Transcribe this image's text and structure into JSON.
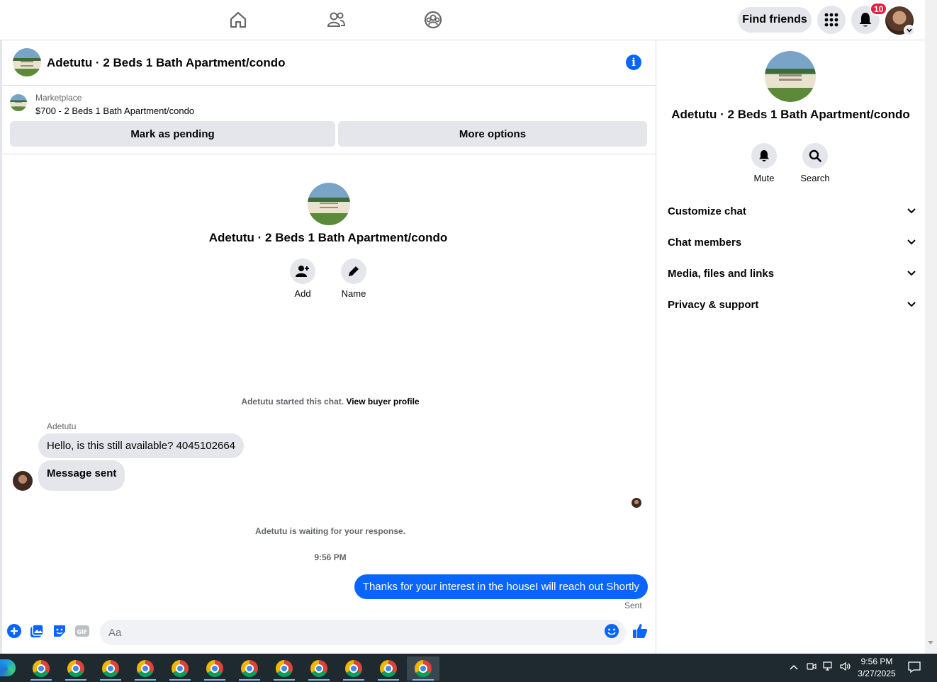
{
  "topnav": {
    "find_friends": "Find friends",
    "notification_count": "10",
    "icons": [
      "home-icon",
      "friends-icon",
      "groups-icon",
      "menu-grid-icon",
      "bell-icon"
    ]
  },
  "chat": {
    "title": "Adetutu · 2 Beds 1 Bath Apartment/condo",
    "marketplace_label": "Marketplace",
    "listing": "$700 - 2 Beds 1 Bath Apartment/condo",
    "mark_pending": "Mark as pending",
    "more_options": "More options",
    "intro_title": "Adetutu · 2 Beds 1 Bath Apartment/condo",
    "actions": [
      {
        "label": "Add"
      },
      {
        "label": "Name"
      }
    ],
    "started_text": "Adetutu started this chat.",
    "view_buyer": "View buyer profile",
    "sender_name": "Adetutu",
    "messages_in": [
      "Hello, is this still available? 4045102664",
      "Message sent"
    ],
    "waiting_text": "Adetutu is waiting for your response.",
    "timestamp": "9:56 PM",
    "message_out": "Thanks for your interest in the houseI will reach out Shortly",
    "sent_status": "Sent",
    "composer_placeholder": "Aa"
  },
  "right_panel": {
    "title": "Adetutu · 2 Beds 1 Bath Apartment/condo",
    "actions": [
      {
        "label": "Mute"
      },
      {
        "label": "Search"
      }
    ],
    "sections": [
      "Customize chat",
      "Chat members",
      "Media, files and links",
      "Privacy & support"
    ]
  },
  "taskbar": {
    "time": "9:56 PM",
    "date": "3/27/2025"
  },
  "colors": {
    "accent": "#0866ff",
    "badge": "#e41e3f",
    "surface": "#e4e6eb"
  }
}
